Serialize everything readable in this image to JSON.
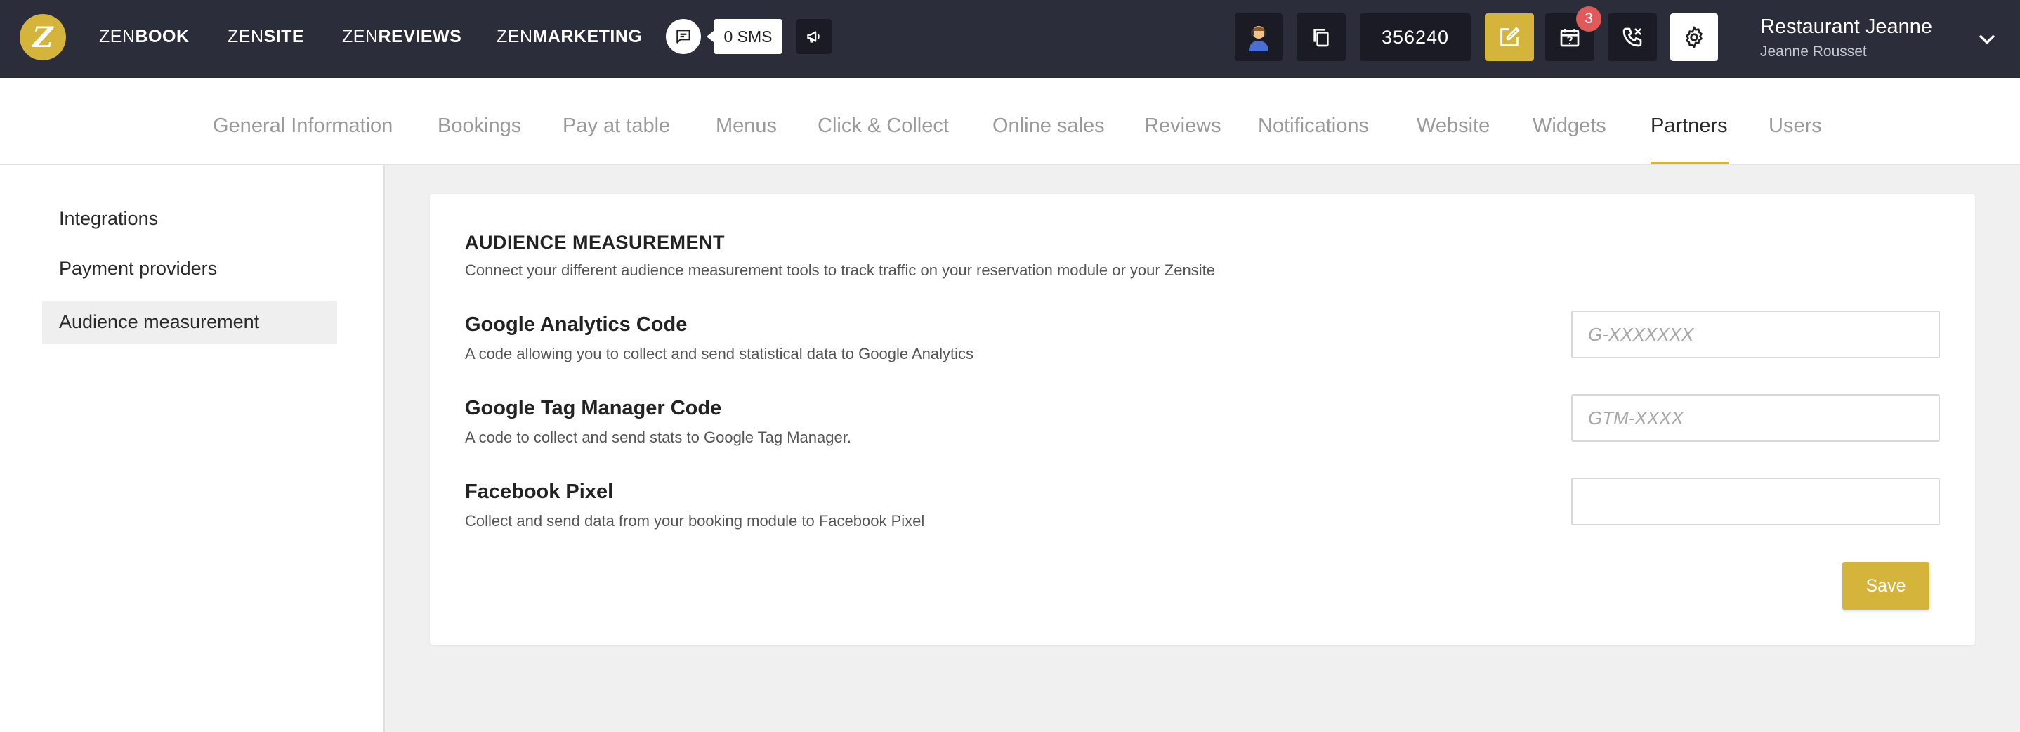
{
  "topbar": {
    "logo_letter": "Z",
    "products": [
      {
        "prefix": "ZEN",
        "suffix": "BOOK"
      },
      {
        "prefix": "ZEN",
        "suffix": "SITE"
      },
      {
        "prefix": "ZEN",
        "suffix": "REVIEWS"
      },
      {
        "prefix": "ZEN",
        "suffix": "MARKETING"
      }
    ],
    "sms_label": "0 SMS",
    "code": "356240",
    "notification_count": "3",
    "restaurant_name": "Restaurant Jeanne",
    "user_name": "Jeanne Rousset",
    "icons": [
      "chat-icon",
      "megaphone-icon",
      "support-agent-icon",
      "copy-icon",
      "edit-icon",
      "calendar-icon",
      "phone-icon",
      "gear-icon",
      "chevron-down-icon"
    ]
  },
  "tabs": [
    {
      "label": "General Information",
      "active": false
    },
    {
      "label": "Bookings",
      "active": false
    },
    {
      "label": "Pay at table",
      "active": false
    },
    {
      "label": "Menus",
      "active": false
    },
    {
      "label": "Click & Collect",
      "active": false
    },
    {
      "label": "Online sales",
      "active": false
    },
    {
      "label": "Reviews",
      "active": false
    },
    {
      "label": "Notifications",
      "active": false
    },
    {
      "label": "Website",
      "active": false
    },
    {
      "label": "Widgets",
      "active": false
    },
    {
      "label": "Partners",
      "active": true
    },
    {
      "label": "Users",
      "active": false
    }
  ],
  "sidebar": {
    "items": [
      {
        "label": "Integrations",
        "active": false
      },
      {
        "label": "Payment providers",
        "active": false
      },
      {
        "label": "Audience measurement",
        "active": true
      }
    ]
  },
  "section": {
    "title": "AUDIENCE MEASUREMENT",
    "description": "Connect your different audience measurement tools to track traffic on your reservation module or your Zensite",
    "fields": [
      {
        "label": "Google Analytics Code",
        "description": "A code allowing you to collect and send statistical data to Google Analytics",
        "placeholder": "G-XXXXXXX",
        "value": ""
      },
      {
        "label": "Google Tag Manager Code",
        "description": "A code to collect and send stats to Google Tag Manager.",
        "placeholder": "GTM-XXXX",
        "value": ""
      },
      {
        "label": "Facebook Pixel",
        "description": "Collect and send data from your booking module to Facebook Pixel",
        "placeholder": "",
        "value": ""
      }
    ],
    "save_label": "Save"
  },
  "colors": {
    "topbar_bg": "#2b2d3a",
    "accent": "#d4b43a",
    "badge_red": "#e05a5a",
    "page_bg": "#f0f0f0"
  }
}
